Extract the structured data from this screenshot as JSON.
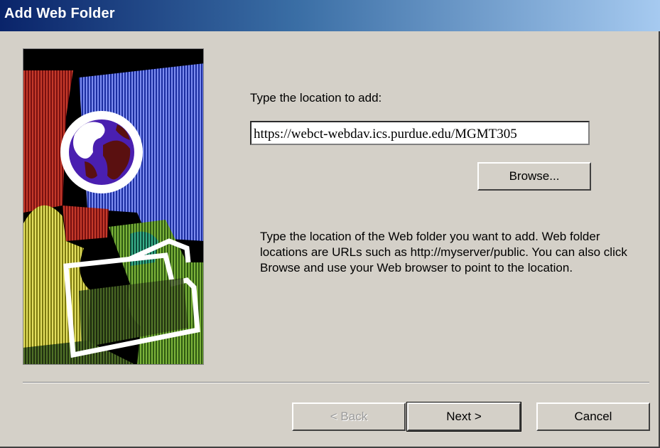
{
  "window": {
    "title": "Add Web Folder"
  },
  "form": {
    "prompt": "Type the location to add:",
    "location_value": "https://webct-webdav.ics.purdue.edu/MGMT305",
    "browse_label": "Browse...",
    "help_text": "Type the location of the Web folder you want to add. Web folder locations are URLs such as http://myserver/public. You can also click Browse and use your Web browser to point to the location."
  },
  "buttons": {
    "back_label": "< Back",
    "next_label": "Next >",
    "cancel_label": "Cancel"
  },
  "icons": {
    "wizard_art": "web-folder-wizard-art"
  },
  "colors": {
    "titlebar_start": "#0a246a",
    "titlebar_end": "#a6caf0",
    "dialog_bg": "#d4d0c8"
  }
}
